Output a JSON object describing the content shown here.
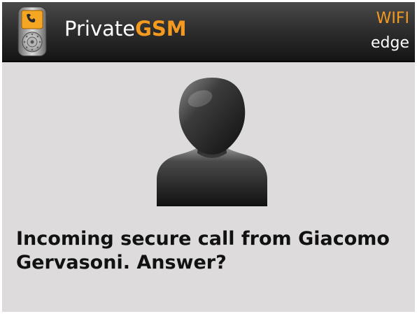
{
  "header": {
    "app_name_prefix": "Private",
    "app_name_suffix": "GSM",
    "network_primary": "WIFI",
    "network_secondary": "edge",
    "icon": "secure-phone-app-icon"
  },
  "call": {
    "avatar_icon": "person-silhouette-icon",
    "message": "Incoming secure call from Giacomo Gervasoni. Answer?"
  },
  "colors": {
    "accent": "#f49a1e",
    "header_bg": "#2b2b2b",
    "screen_bg": "#dddbdc",
    "text": "#111111"
  }
}
